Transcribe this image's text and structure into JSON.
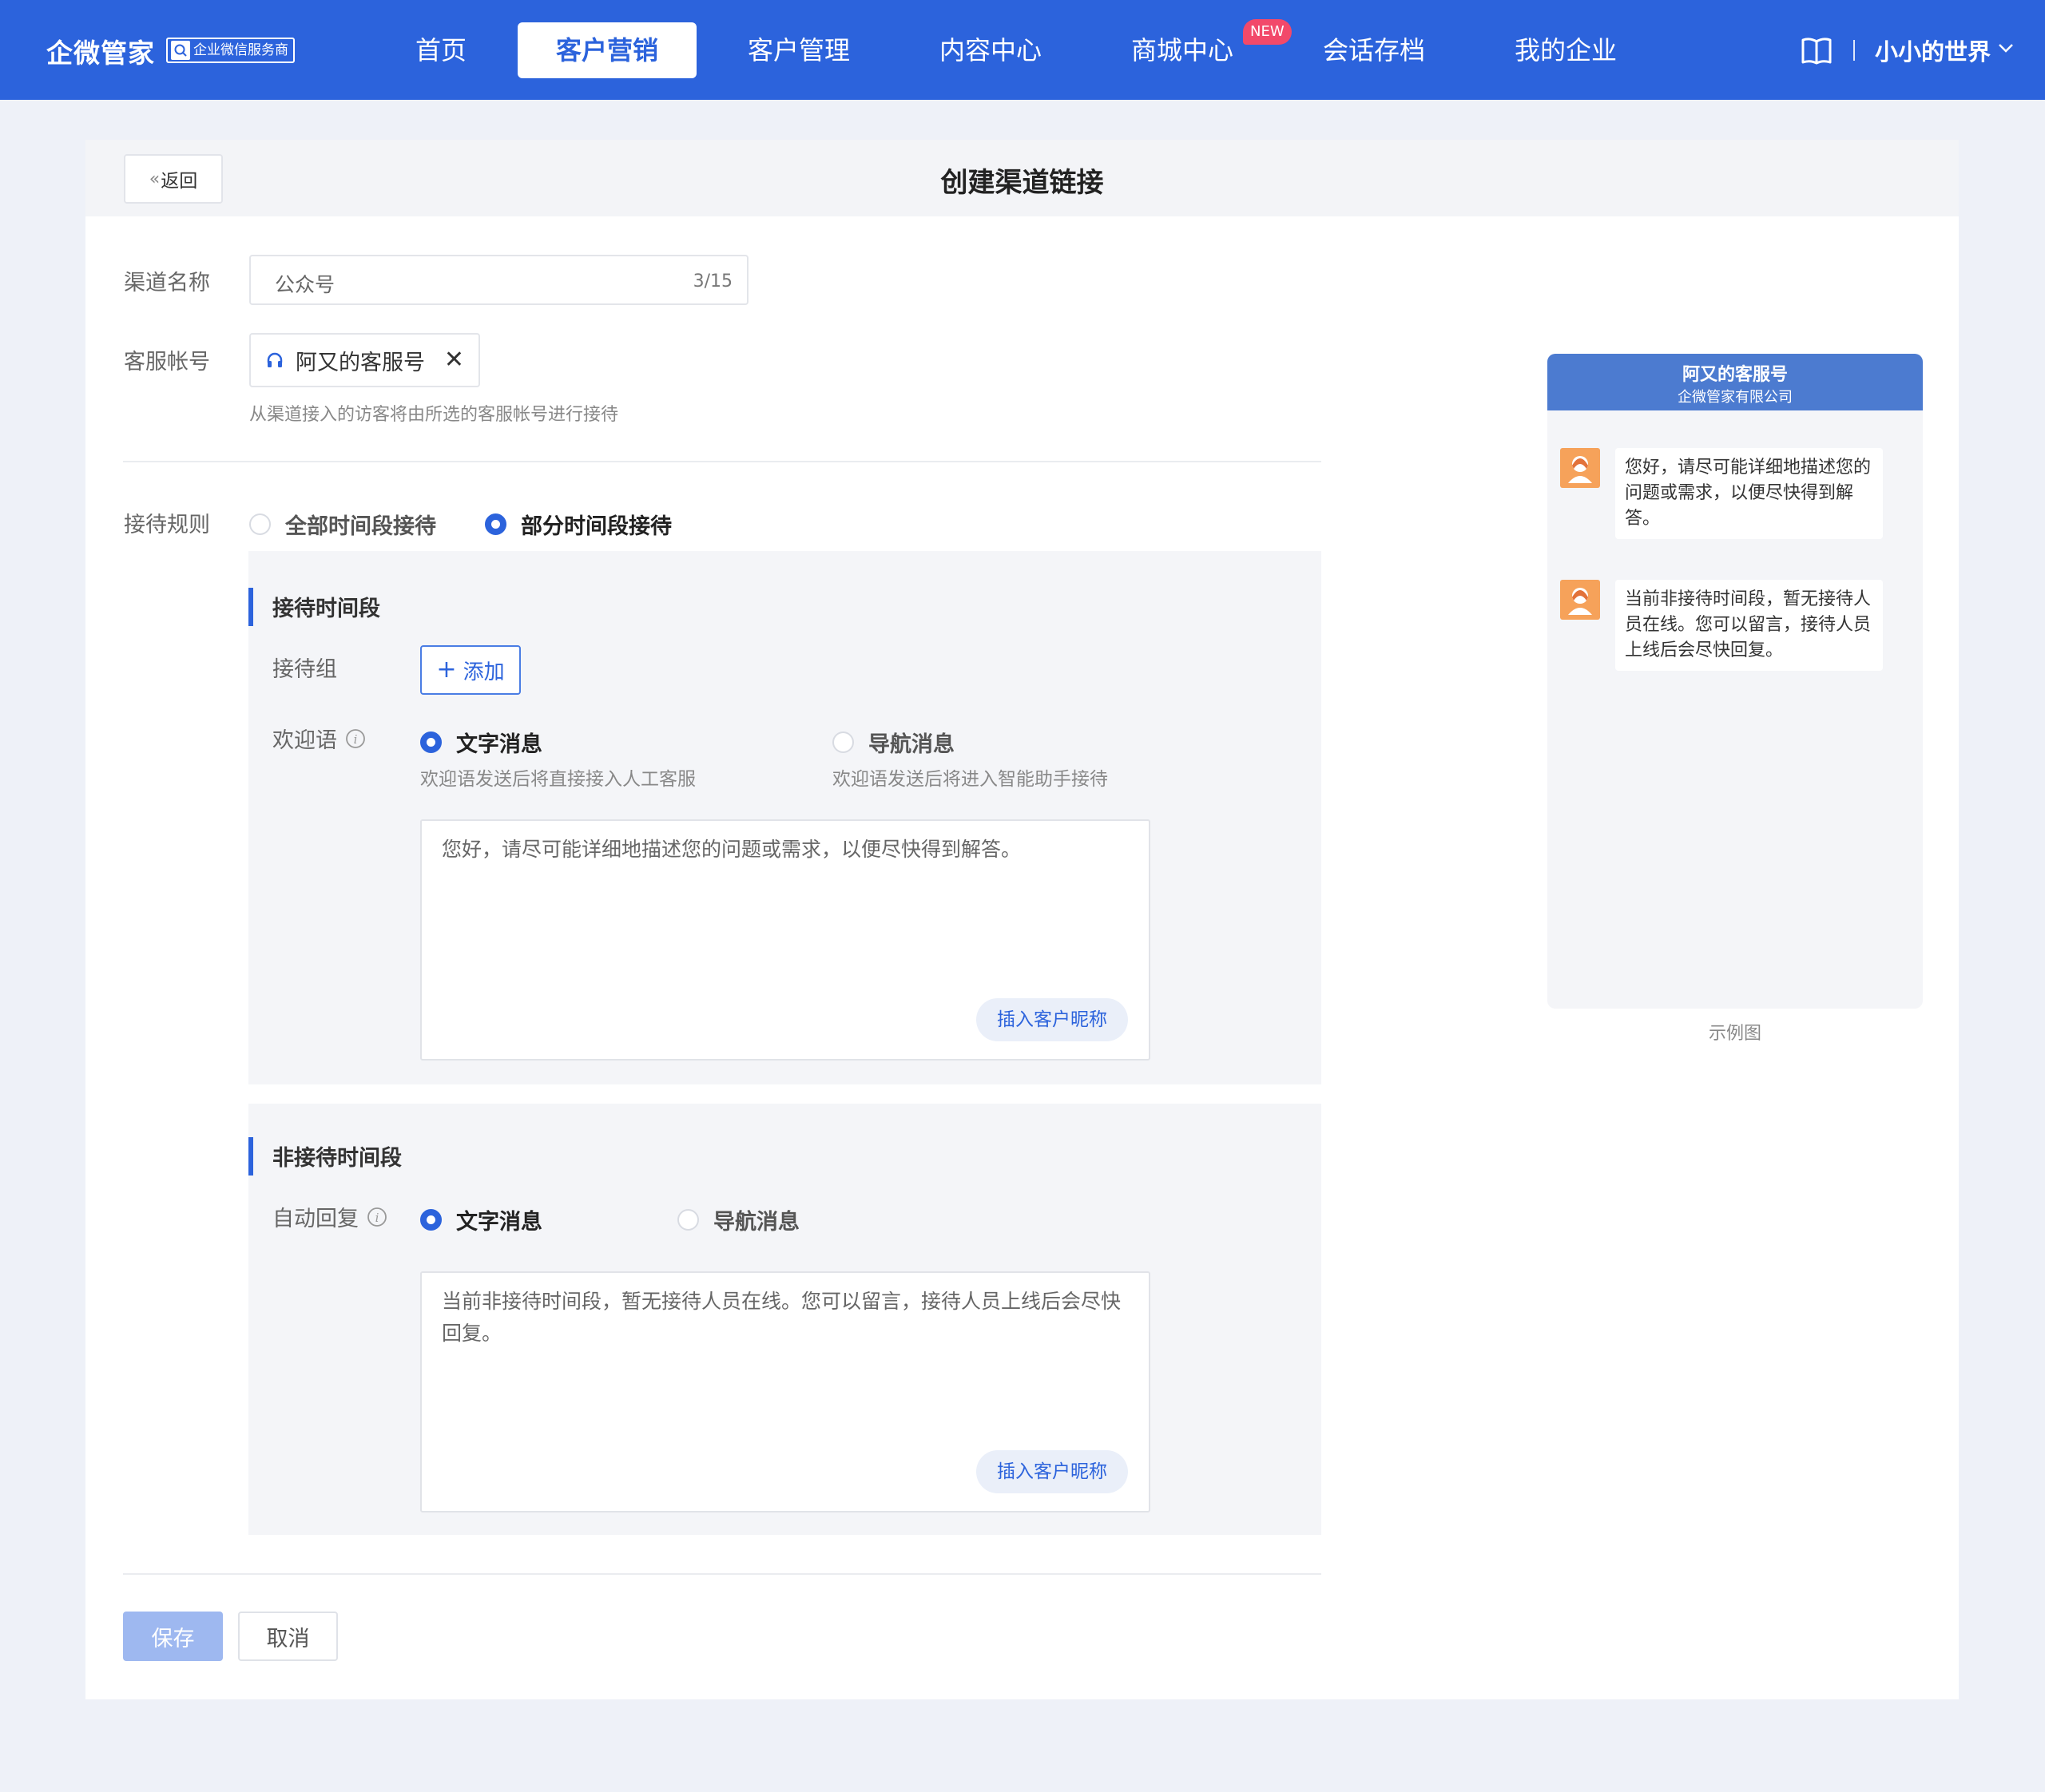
{
  "brand": {
    "name": "企微管家",
    "badge": "企业微信服务商"
  },
  "nav": {
    "items": [
      "首页",
      "客户营销",
      "客户管理",
      "内容中心",
      "商城中心",
      "会话存档",
      "我的企业"
    ],
    "new_badge": "NEW",
    "user_name": "小小的世界",
    "active_color": "#2c63dc"
  },
  "header": {
    "back_label": "返回",
    "title": "创建渠道链接"
  },
  "form": {
    "channel_name_label": "渠道名称",
    "channel_name_value": "公众号",
    "channel_name_count": "3/15",
    "service_account_label": "客服帐号",
    "service_account_value": "阿又的客服号",
    "service_account_hint": "从渠道接入的访客将由所选的客服帐号进行接待",
    "rule_label": "接待规则",
    "rule_options": [
      "全部时间段接待",
      "部分时间段接待"
    ],
    "rule_selected": "部分时间段接待"
  },
  "reception": {
    "section_title": "接待时间段",
    "group_label": "接待组",
    "add_button": "添加",
    "welcome_label": "欢迎语",
    "welcome_options": [
      "文字消息",
      "导航消息"
    ],
    "welcome_selected": "文字消息",
    "text_option_hint": "欢迎语发送后将直接接入人工客服",
    "nav_option_hint": "欢迎语发送后将进入智能助手接待",
    "welcome_text": "您好，请尽可能详细地描述您的问题或需求，以便尽快得到解答。",
    "insert_nickname": "插入客户昵称"
  },
  "non_reception": {
    "section_title": "非接待时间段",
    "auto_reply_label": "自动回复",
    "reply_options": [
      "文字消息",
      "导航消息"
    ],
    "reply_selected": "文字消息",
    "reply_text": "当前非接待时间段，暂无接待人员在线。您可以留言，接待人员上线后会尽快回复。",
    "insert_nickname": "插入客户昵称"
  },
  "actions": {
    "save": "保存",
    "cancel": "取消"
  },
  "preview": {
    "account_name": "阿又的客服号",
    "company": "企微管家有限公司",
    "messages": [
      "您好，请尽可能详细地描述您的问题或需求，以便尽快得到解答。",
      "当前非接待时间段，暂无接待人员在线。您可以留言，接待人员上线后会尽快回复。"
    ],
    "caption": "示例图"
  }
}
